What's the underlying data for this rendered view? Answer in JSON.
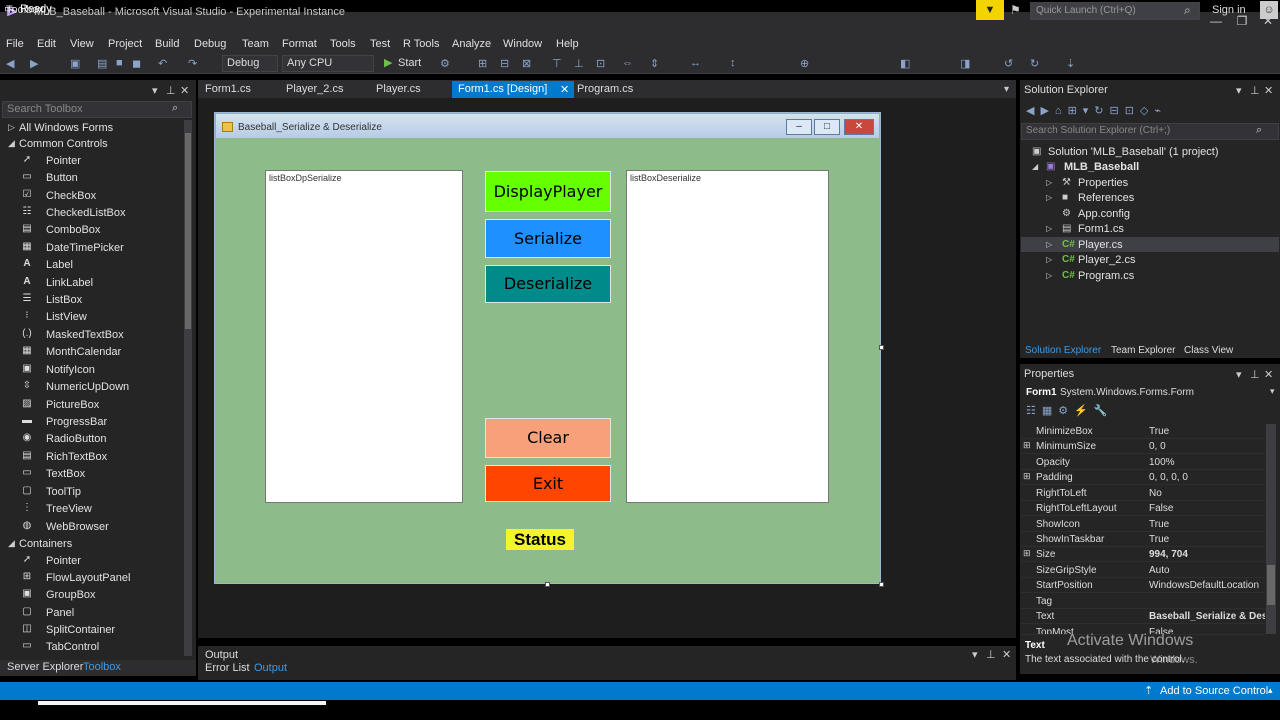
{
  "window": {
    "title": "MLB_Baseball - Microsoft Visual Studio - Experimental Instance",
    "quick_launch_placeholder": "Quick Launch (Ctrl+Q)",
    "sign_in": "Sign in"
  },
  "menu": [
    "File",
    "Edit",
    "View",
    "Project",
    "Build",
    "Debug",
    "Team",
    "Format",
    "Tools",
    "Test",
    "R Tools",
    "Analyze",
    "Window",
    "Help"
  ],
  "toolbar": {
    "config": "Debug",
    "platform": "Any CPU",
    "start": "Start"
  },
  "toolbox": {
    "title": "Toolbox",
    "search_placeholder": "Search Toolbox",
    "groups": [
      {
        "label": "All Windows Forms"
      },
      {
        "label": "Common Controls"
      },
      {
        "label": "Containers"
      }
    ],
    "common_controls": [
      "Pointer",
      "Button",
      "CheckBox",
      "CheckedListBox",
      "ComboBox",
      "DateTimePicker",
      "Label",
      "LinkLabel",
      "ListBox",
      "ListView",
      "MaskedTextBox",
      "MonthCalendar",
      "NotifyIcon",
      "NumericUpDown",
      "PictureBox",
      "ProgressBar",
      "RadioButton",
      "RichTextBox",
      "TextBox",
      "ToolTip",
      "TreeView",
      "WebBrowser"
    ],
    "containers": [
      "Pointer",
      "FlowLayoutPanel",
      "GroupBox",
      "Panel",
      "SplitContainer",
      "TabControl"
    ],
    "tabs": [
      "Server Explorer",
      "Toolbox"
    ]
  },
  "doc_tabs": [
    "Form1.cs",
    "Player_2.cs",
    "Player.cs",
    "Form1.cs [Design]",
    "Program.cs"
  ],
  "form": {
    "caption": "Baseball_Serialize & Deserialize",
    "listbox_left": "listBoxDpSerialize",
    "listbox_right": "listBoxDeserialize",
    "btn_display": "DisplayPlayer",
    "btn_serialize": "Serialize",
    "btn_deserialize": "Deserialize",
    "btn_clear": "Clear",
    "btn_exit": "Exit",
    "status": "Status",
    "colors": {
      "background": "#8dbb89",
      "display": "#66ff00",
      "serialize": "#1e90ff",
      "deserialize": "#008b8b",
      "clear": "#f7a07a",
      "exit": "#ff4500",
      "status": "#f4f42a"
    }
  },
  "output": {
    "title": "Output",
    "tab_error_list": "Error List",
    "tab_output": "Output"
  },
  "solution_explorer": {
    "title": "Solution Explorer",
    "search_placeholder": "Search Solution Explorer (Ctrl+;)",
    "solution": "Solution 'MLB_Baseball' (1 project)",
    "project": "MLB_Baseball",
    "items": [
      "Properties",
      "References",
      "App.config",
      "Form1.cs",
      "Player.cs",
      "Player_2.cs",
      "Program.cs"
    ],
    "tabs": [
      "Solution Explorer",
      "Team Explorer",
      "Class View"
    ]
  },
  "properties": {
    "title": "Properties",
    "object": "Form1",
    "object_type": "System.Windows.Forms.Form",
    "rows": [
      {
        "name": "MinimizeBox",
        "value": "True"
      },
      {
        "name": "MinimumSize",
        "value": "0, 0"
      },
      {
        "name": "Opacity",
        "value": "100%"
      },
      {
        "name": "Padding",
        "value": "0, 0, 0, 0"
      },
      {
        "name": "RightToLeft",
        "value": "No"
      },
      {
        "name": "RightToLeftLayout",
        "value": "False"
      },
      {
        "name": "ShowIcon",
        "value": "True"
      },
      {
        "name": "ShowInTaskbar",
        "value": "True"
      },
      {
        "name": "Size",
        "value": "994, 704"
      },
      {
        "name": "SizeGripStyle",
        "value": "Auto"
      },
      {
        "name": "StartPosition",
        "value": "WindowsDefaultLocation"
      },
      {
        "name": "Tag",
        "value": ""
      },
      {
        "name": "Text",
        "value": "Baseball_Serialize & Deserialize"
      },
      {
        "name": "TopMost",
        "value": "False"
      }
    ],
    "desc_title": "Text",
    "desc_text": "The text associated with the control.",
    "watermark_1": "Activate Windows",
    "watermark_2": "Windows."
  },
  "statusbar": {
    "ready": "Ready",
    "source_control": "Add to Source Control"
  }
}
